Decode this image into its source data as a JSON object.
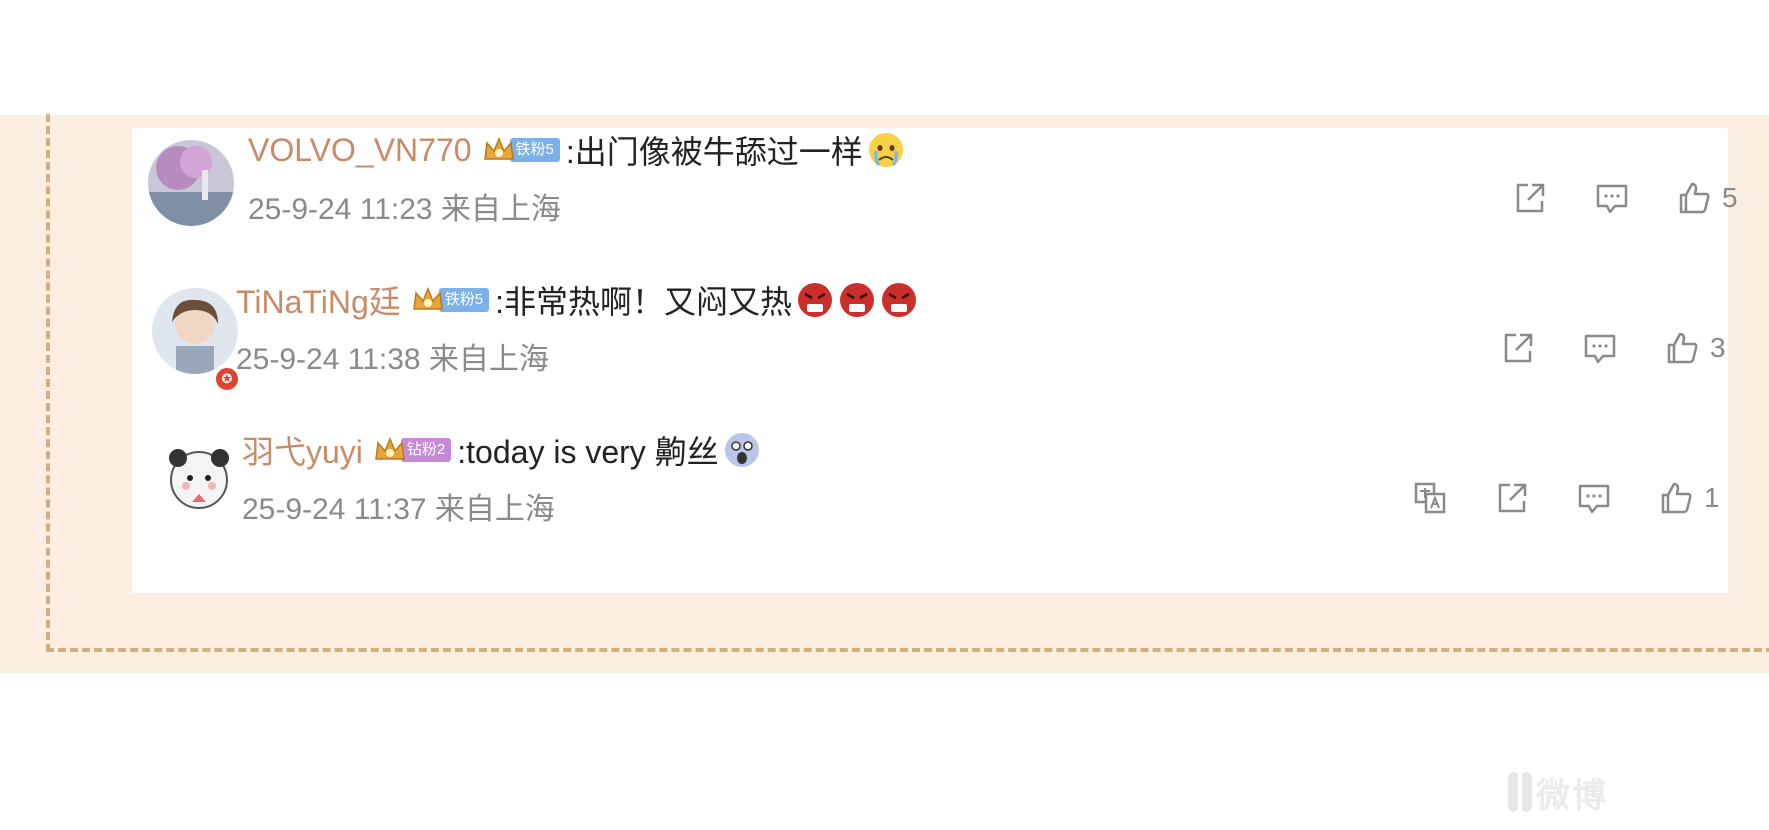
{
  "comments": [
    {
      "username": "VOLVO_VN770",
      "fan_badge": "铁粉5",
      "content": ":出门像被牛舔过一样",
      "emojis": [
        "crying-emoji"
      ],
      "timestamp": "25-9-24 11:23 来自上海",
      "likes": "5"
    },
    {
      "username": "TiNaTiNg廷",
      "fan_badge": "铁粉5",
      "content": ":非常热啊！又闷又热",
      "emojis": [
        "angry-emoji",
        "angry-emoji",
        "angry-emoji"
      ],
      "timestamp": "25-9-24 11:38 来自上海",
      "likes": "3"
    },
    {
      "username": "羽弋yuyi",
      "fan_badge": "钻粉2",
      "content": ":today is very 齁丝",
      "emojis": [
        "shocked-emoji"
      ],
      "timestamp": "25-9-24 11:37 来自上海",
      "likes": "1"
    }
  ],
  "icons": {
    "share": "share-icon",
    "comment": "comment-icon",
    "like": "thumbs-up-icon",
    "translate": "translate-icon"
  },
  "colors": {
    "band": "#fcefe1",
    "dash": "#d7ad80",
    "username": "#c98a68",
    "meta": "#8a8a8a",
    "badge_blue": "#7bb0e8",
    "badge_purple": "#c68ad8"
  },
  "watermark": "微博"
}
